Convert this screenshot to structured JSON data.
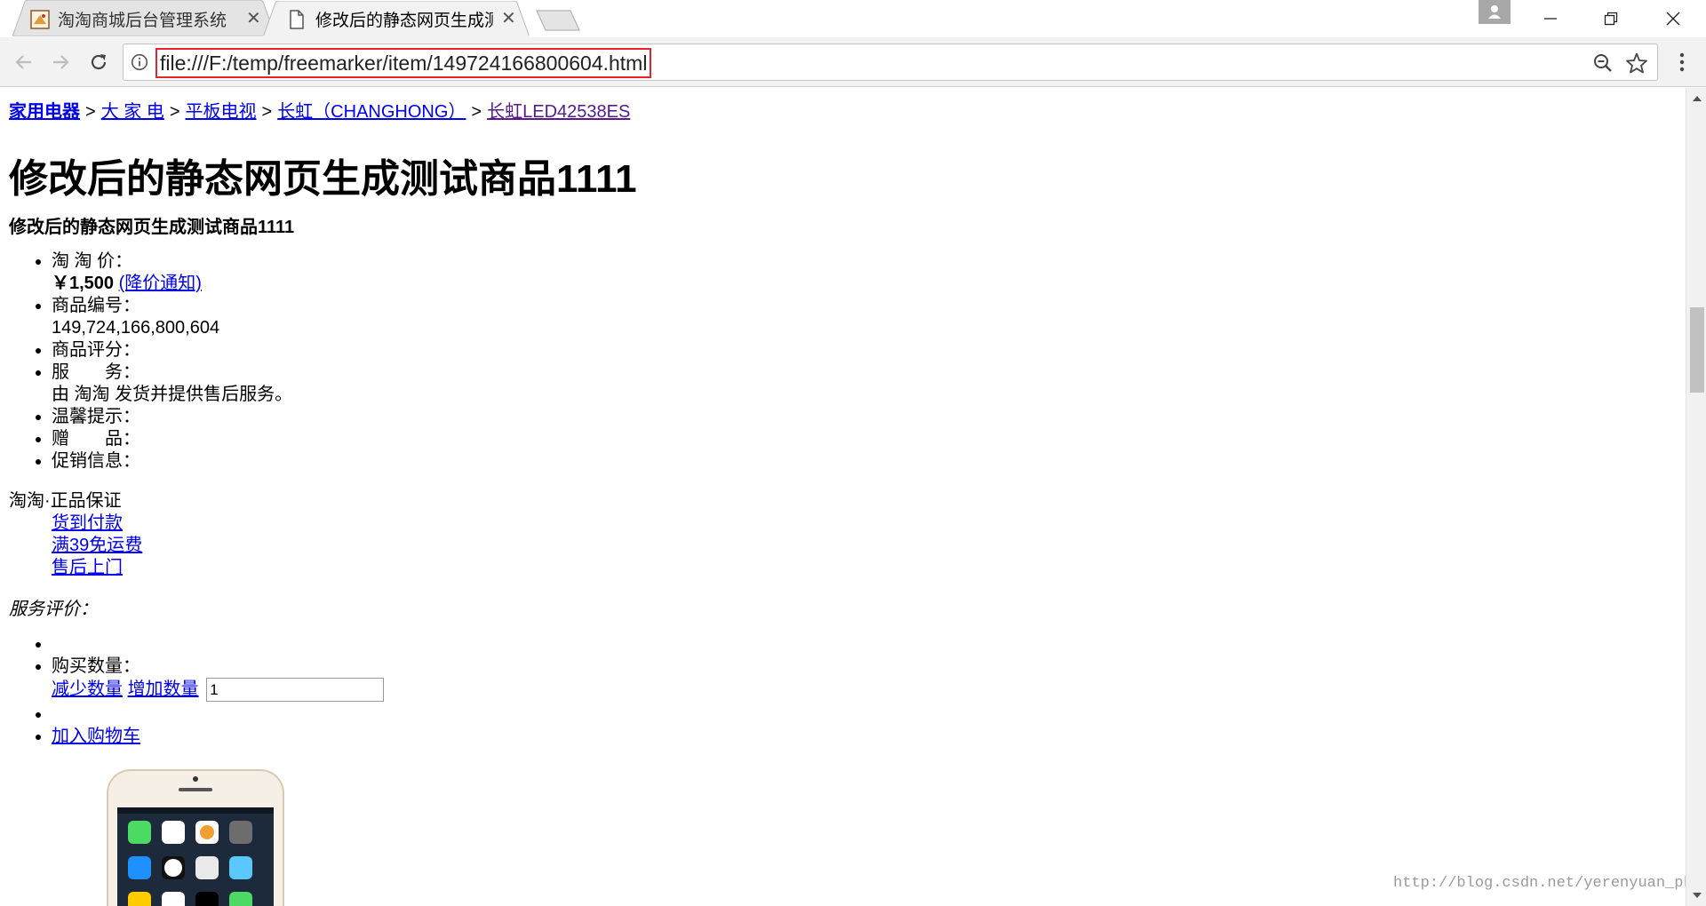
{
  "browser": {
    "tabs": [
      {
        "title": "淘淘商城后台管理系统",
        "active": false,
        "icon": "admin-favicon-icon"
      },
      {
        "title": "修改后的静态网页生成测",
        "active": true,
        "icon": "document-icon"
      }
    ],
    "url": "file:///F:/temp/freemarker/item/149724166800604.html"
  },
  "breadcrumb": {
    "items": [
      {
        "label": "家用电器",
        "bold": true
      },
      {
        "label": "大 家 电"
      },
      {
        "label": "平板电视"
      },
      {
        "label": "长虹（CHANGHONG）"
      },
      {
        "label": "长虹LED42538ES",
        "visited": true
      }
    ],
    "separator": ">"
  },
  "product": {
    "title": "修改后的静态网页生成测试商品1111",
    "subtitle": "修改后的静态网页生成测试商品1111",
    "price_label": "淘 淘 价：",
    "price": "￥1,500",
    "price_notify": "(降价通知)",
    "id_label": "商品编号：",
    "id_value": "149,724,166,800,604",
    "rating_label": "商品评分：",
    "service_label": "服　　务：",
    "service_value": "由 淘淘 发货并提供售后服务。",
    "tips_label": "温馨提示：",
    "gift_label": "赠　　品：",
    "promo_label": "促销信息："
  },
  "guarantee": {
    "title": "淘淘·正品保证",
    "links": [
      "货到付款",
      "满39免运费",
      "售后上门"
    ]
  },
  "service_review": "服务评价：",
  "purchase": {
    "qty_label": "购买数量：",
    "decrease": "减少数量",
    "increase": "增加数量",
    "qty_value": "1",
    "add_to_cart": "加入购物车"
  },
  "watermark": "http://blog.csdn.net/yerenyuan_pku"
}
